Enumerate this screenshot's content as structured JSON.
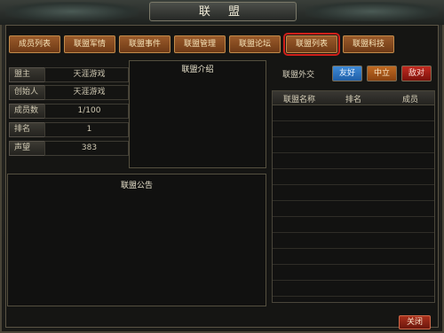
{
  "window": {
    "title": "联 盟"
  },
  "tabs": [
    "成员列表",
    "联盟军情",
    "联盟事件",
    "联盟管理",
    "联盟论坛",
    "联盟列表",
    "联盟科技"
  ],
  "info": [
    {
      "label": "盟主",
      "value": "天涯游戏"
    },
    {
      "label": "创始人",
      "value": "天涯游戏"
    },
    {
      "label": "成员数",
      "value": "1/100"
    },
    {
      "label": "排名",
      "value": "1"
    },
    {
      "label": "声望",
      "value": "383"
    }
  ],
  "intro": {
    "title": "联盟介绍"
  },
  "notice": {
    "title": "联盟公告"
  },
  "diplomacy": {
    "label": "联盟外交",
    "friendly": "友好",
    "neutral": "中立",
    "hostile": "敌对"
  },
  "list": {
    "headers": [
      "联盟名称",
      "排名",
      "成员"
    ]
  },
  "close_label": "关闭",
  "colors": {
    "tab_active_border": "#d0201a",
    "friendly": "#2f79c8",
    "neutral": "#b05a18",
    "hostile": "#b01a14"
  }
}
